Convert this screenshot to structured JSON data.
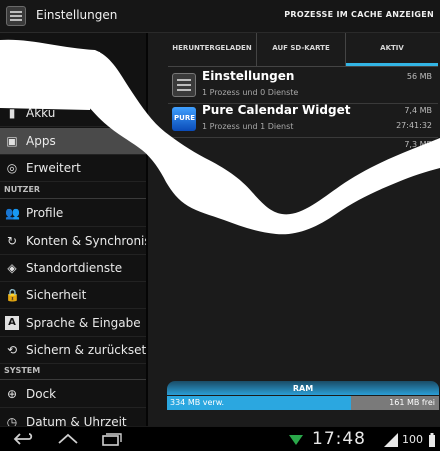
{
  "actionbar": {
    "title": "Einstellungen",
    "action": "PROZESSE IM CACHE ANZEIGEN",
    "icon": "settings-sliders-icon"
  },
  "sidebar": {
    "items": [
      {
        "label": "Akku",
        "icon": "battery-icon"
      },
      {
        "label": "Apps",
        "icon": "apps-icon",
        "selected": true
      },
      {
        "label": "Erweitert",
        "icon": "advanced-icon"
      }
    ],
    "section_user": "NUTZER",
    "user_items": [
      {
        "label": "Profile",
        "icon": "profile-icon"
      },
      {
        "label": "Konten & Synchronis",
        "icon": "sync-icon"
      },
      {
        "label": "Standortdienste",
        "icon": "location-icon"
      },
      {
        "label": "Sicherheit",
        "icon": "lock-icon"
      },
      {
        "label": "Sprache & Eingabe",
        "icon": "language-icon"
      },
      {
        "label": "Sichern & zurücksetz",
        "icon": "backup-icon"
      }
    ],
    "section_system": "SYSTEM",
    "system_items": [
      {
        "label": "Dock",
        "icon": "dock-icon"
      },
      {
        "label": "Datum & Uhrzeit",
        "icon": "clock-icon"
      }
    ]
  },
  "tabs": [
    {
      "label": "HERUNTERGELADEN"
    },
    {
      "label": "AUF SD-KARTE"
    },
    {
      "label": "AKTIV",
      "selected": true
    }
  ],
  "processes": [
    {
      "name": "Einstellungen",
      "desc": "1 Prozess und 0 Dienste",
      "size": "56 MB",
      "time": ""
    },
    {
      "name": "Pure Calendar Widget",
      "desc": "1 Prozess und 1 Dienst",
      "size": "7,4 MB",
      "time": "27:41:32",
      "icon_text": "PURE"
    },
    {
      "name": "",
      "desc": "",
      "size": "7,3 MB",
      "time": ""
    }
  ],
  "ram": {
    "title": "RAM",
    "used": "334 MB verw.",
    "free": "161 MB frei",
    "used_fraction": 0.675,
    "accent": "#33b5e5"
  },
  "statusbar": {
    "clock": "17:48",
    "battery": "100"
  }
}
